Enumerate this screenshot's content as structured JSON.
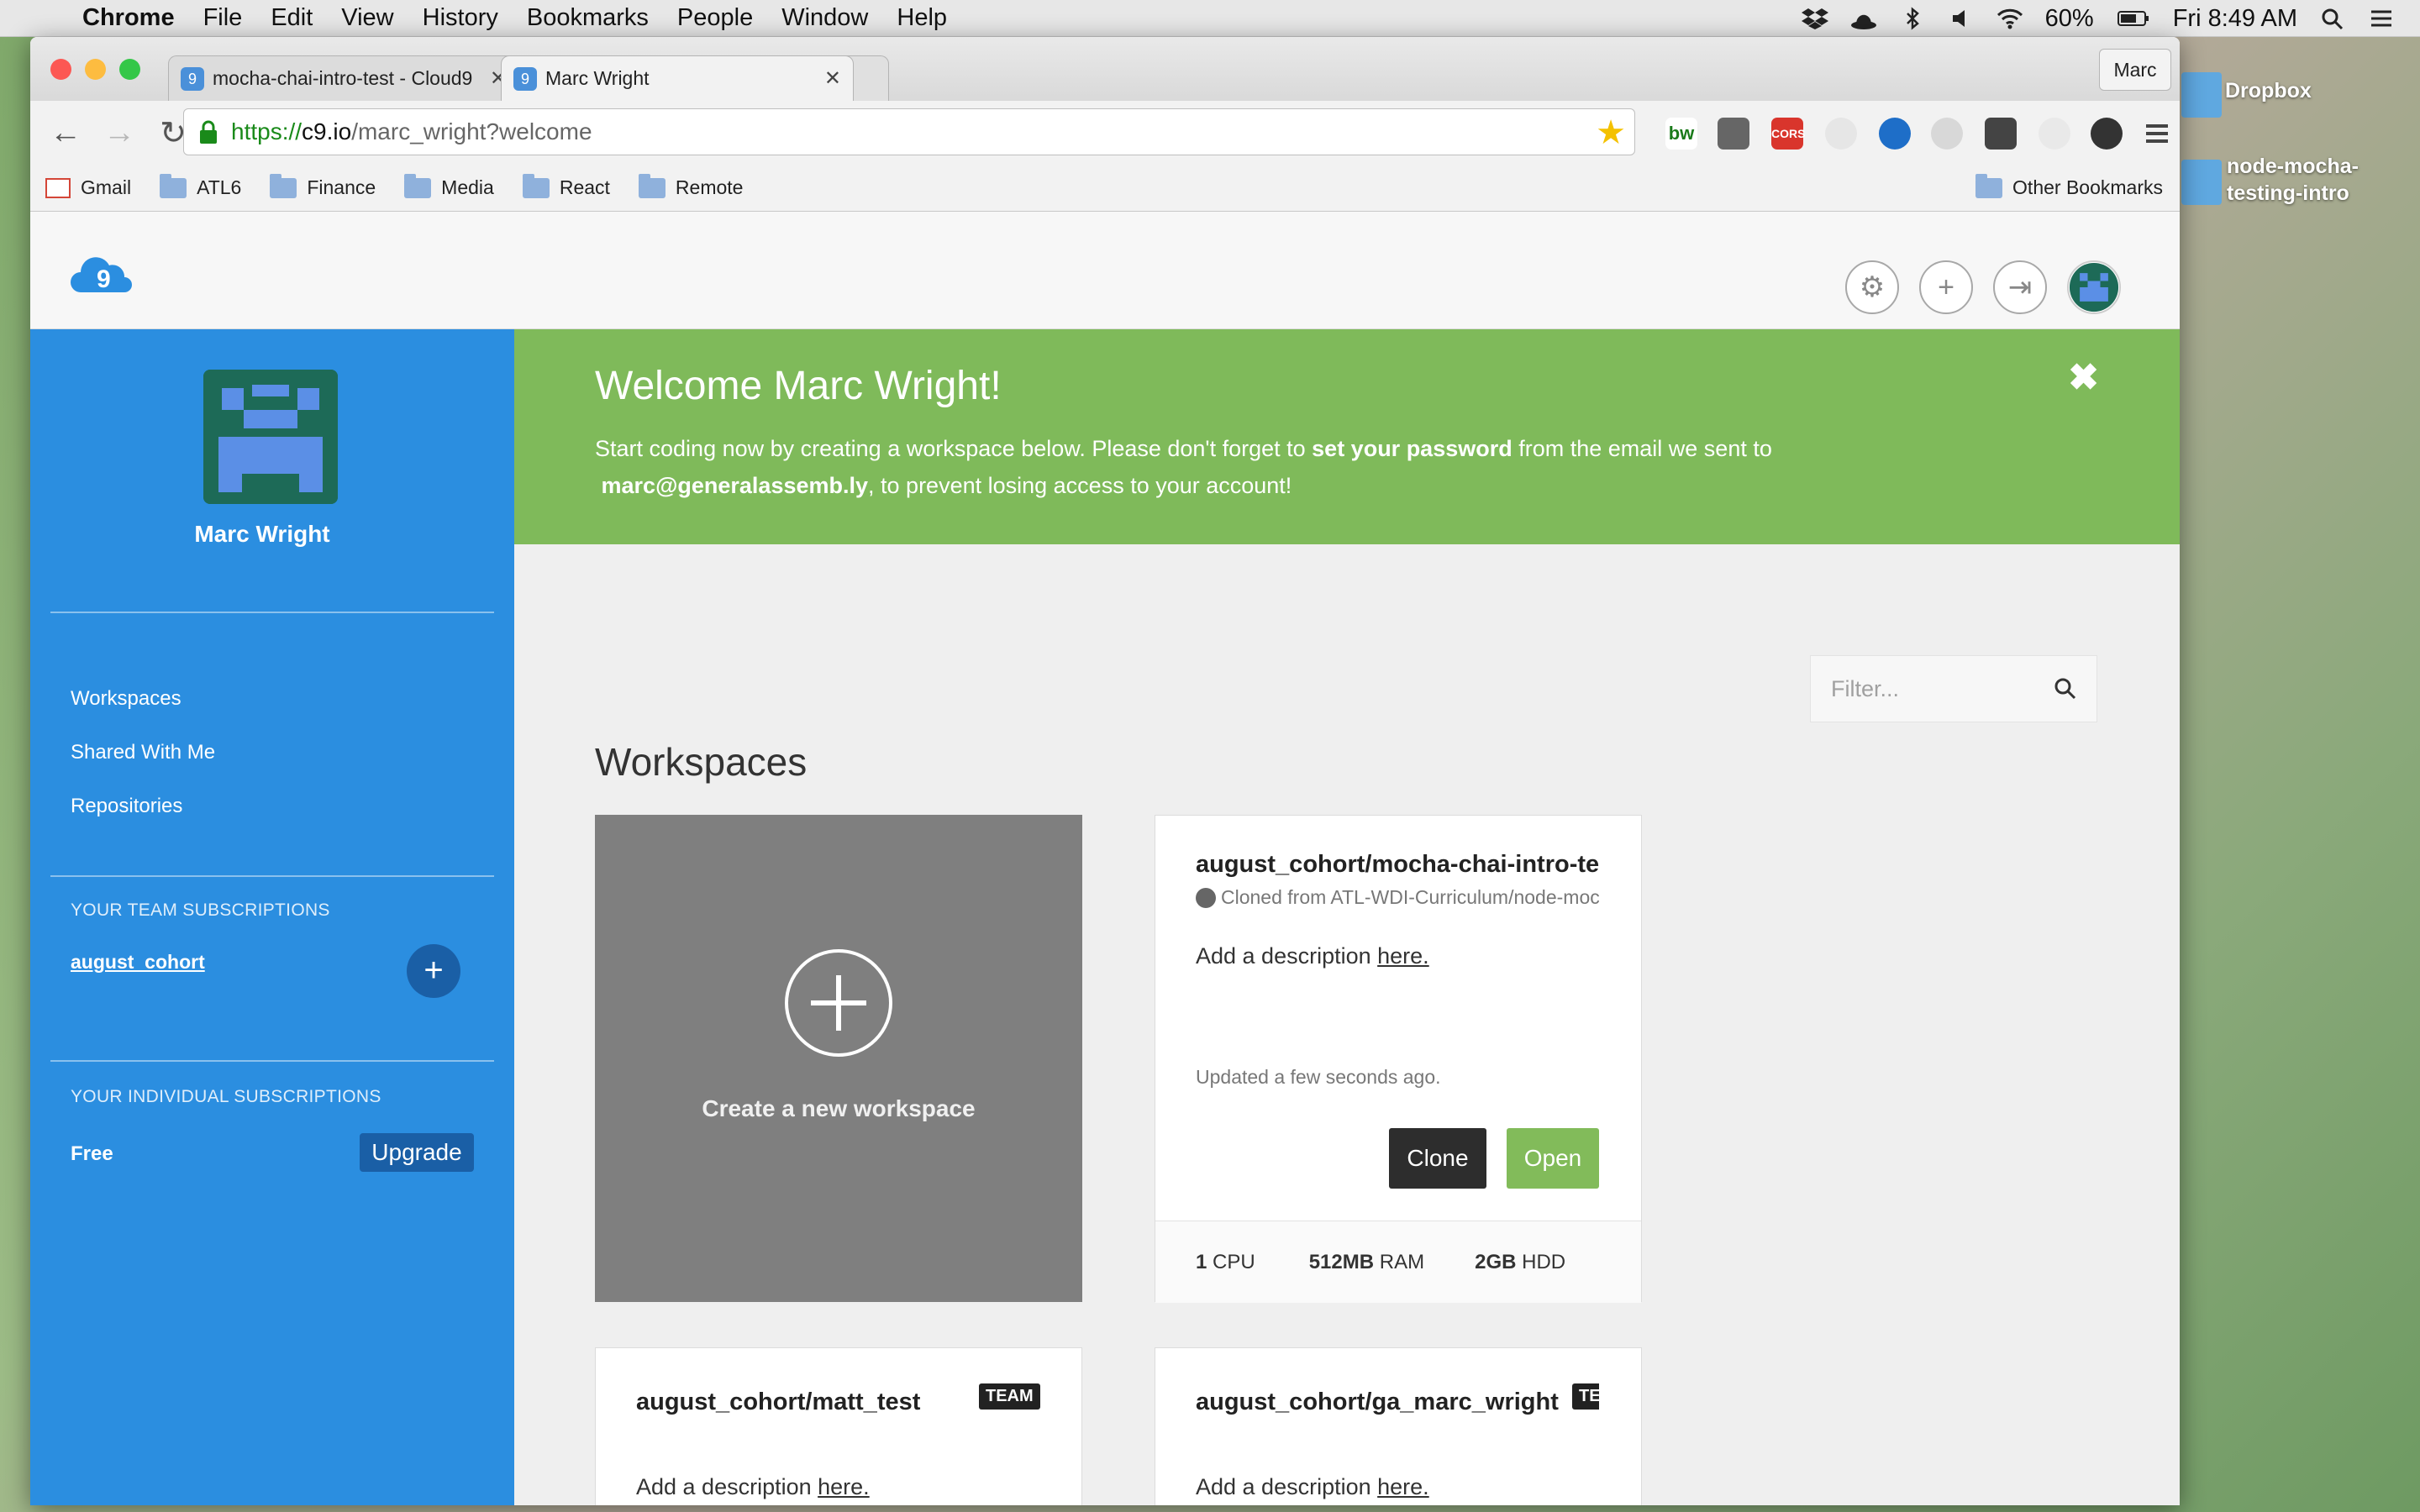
{
  "menubar": {
    "app": "Chrome",
    "items": [
      "File",
      "Edit",
      "View",
      "History",
      "Bookmarks",
      "People",
      "Window",
      "Help"
    ],
    "battery": "60%",
    "clock": "Fri 8:49 AM"
  },
  "desktop": {
    "items": [
      "Dropbox",
      "node-mocha-testing-intro"
    ]
  },
  "browser": {
    "tabs": [
      {
        "title": "mocha-chai-intro-test - Cloud9"
      },
      {
        "title": "Marc Wright"
      }
    ],
    "profile": "Marc",
    "url": {
      "scheme": "https://",
      "host": "c9.io",
      "path": "/marc_wright?welcome"
    },
    "bookmarks": [
      "Gmail",
      "ATL6",
      "Finance",
      "Media",
      "React",
      "Remote"
    ],
    "other_bookmarks": "Other Bookmarks"
  },
  "sidebar": {
    "user_name": "Marc Wright",
    "links": [
      "Workspaces",
      "Shared With Me",
      "Repositories"
    ],
    "team_heading": "YOUR TEAM SUBSCRIPTIONS",
    "team": "august_cohort",
    "individual_heading": "YOUR INDIVIDUAL SUBSCRIPTIONS",
    "plan": "Free",
    "upgrade": "Upgrade"
  },
  "banner": {
    "title": "Welcome Marc Wright!",
    "line_a": "Start coding now by creating a workspace below. Please don't forget to ",
    "strong_a": "set your password",
    "line_b": " from the email we sent to ",
    "email": "marc@generalassemb.ly",
    "line_c": ", to prevent losing access to your account!"
  },
  "main": {
    "filter_placeholder": "Filter...",
    "heading": "Workspaces",
    "create_label": "Create a new workspace",
    "desc_prefix": "Add a description ",
    "desc_link": "here.",
    "workspaces": [
      {
        "name": "august_cohort/mocha-chai-intro-test",
        "cloned_from": "Cloned from ATL-WDI-Curriculum/node-mocha-testing-intro",
        "updated": "Updated a few seconds ago.",
        "clone": "Clone",
        "open": "Open",
        "cpu": "1",
        "cpu_unit": "CPU",
        "ram": "512MB",
        "ram_unit": "RAM",
        "hdd": "2GB",
        "hdd_unit": "HDD"
      },
      {
        "name": "august_cohort/matt_test",
        "badge": "TEAM"
      },
      {
        "name": "august_cohort/ga_marc_wright",
        "badge": "TEAM"
      }
    ]
  },
  "colors": {
    "sidebar": "#2b8ee0",
    "banner": "#7fba5a",
    "open_button": "#82bb5a",
    "clone_button": "#2d2d2d"
  }
}
